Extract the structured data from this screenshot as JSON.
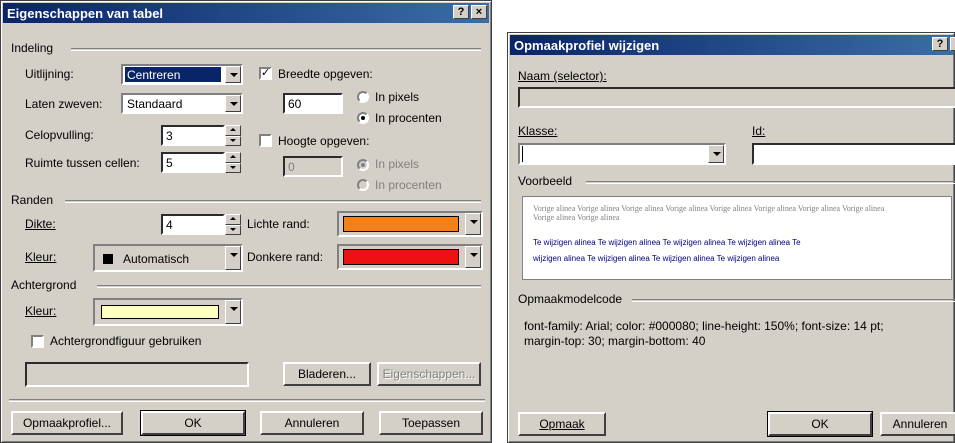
{
  "left": {
    "title": "Eigenschappen van tabel",
    "help_btn": "?",
    "close_btn": "×",
    "indeling": {
      "label": "Indeling",
      "uitlijning_label": "Uitlijning:",
      "uitlijning_value": "Centreren",
      "laten_zweven_label": "Laten zweven:",
      "laten_zweven_value": "Standaard",
      "celopvulling_label": "Celopvulling:",
      "celopvulling_value": "3",
      "ruimte_label": "Ruimte tussen cellen:",
      "ruimte_value": "5",
      "breedte_label": "Breedte opgeven:",
      "breedte_checked": "✓",
      "breedte_value": "60",
      "in_pixels": "In pixels",
      "in_procenten": "In procenten",
      "hoogte_label": "Hoogte opgeven:",
      "hoogte_value": "0",
      "hoogte_in_pixels": "In pixels",
      "hoogte_in_procenten": "In procenten"
    },
    "randen": {
      "label": "Randen",
      "dikte_label": "Dikte:",
      "dikte_value": "4",
      "lichte_rand_label": "Lichte rand:",
      "lichte_rand_color": "#f57f17",
      "kleur_label": "Kleur:",
      "kleur_value": "Automatisch",
      "donkere_rand_label": "Donkere rand:",
      "donkere_rand_color": "#ee1111"
    },
    "achtergrond": {
      "label": "Achtergrond",
      "kleur_label": "Kleur:",
      "kleur_color": "#ffffc0",
      "achtergrondfiguur_label": "Achtergrondfiguur gebruiken",
      "bladeren": "Bladeren...",
      "eigenschappen": "Eigenschappen..."
    },
    "buttons": {
      "opmaakprofiel": "Opmaakprofiel...",
      "ok": "OK",
      "annuleren": "Annuleren",
      "toepassen": "Toepassen"
    }
  },
  "right": {
    "title": "Opmaakprofiel wijzigen",
    "help_btn": "?",
    "close_btn": "×",
    "naam_label": "Naam (selector):",
    "klasse_label": "Klasse:",
    "id_label": "Id:",
    "voorbeeld_label": "Voorbeeld",
    "preview_line1": "Vorige alinea Vorige alinea Vorige alinea Vorige alinea Vorige alinea Vorige alinea Vorige alinea Vorige alinea",
    "preview_line2": "Vorige alinea Vorige alinea",
    "preview_line3": "Te wijzigen alinea Te wijzigen alinea Te wijzigen alinea Te wijzigen alinea Te",
    "preview_line4": "wijzigen alinea Te wijzigen alinea Te wijzigen alinea Te wijzigen alinea",
    "code_label": "Opmaakmodelcode",
    "code_line1": "font-family: Arial; color: #000080; line-height: 150%; font-size: 14 pt;",
    "code_line2": "margin-top: 30; margin-bottom: 40",
    "buttons": {
      "opmaak": "Opmaak",
      "ok": "OK",
      "annuleren": "Annuleren"
    }
  }
}
